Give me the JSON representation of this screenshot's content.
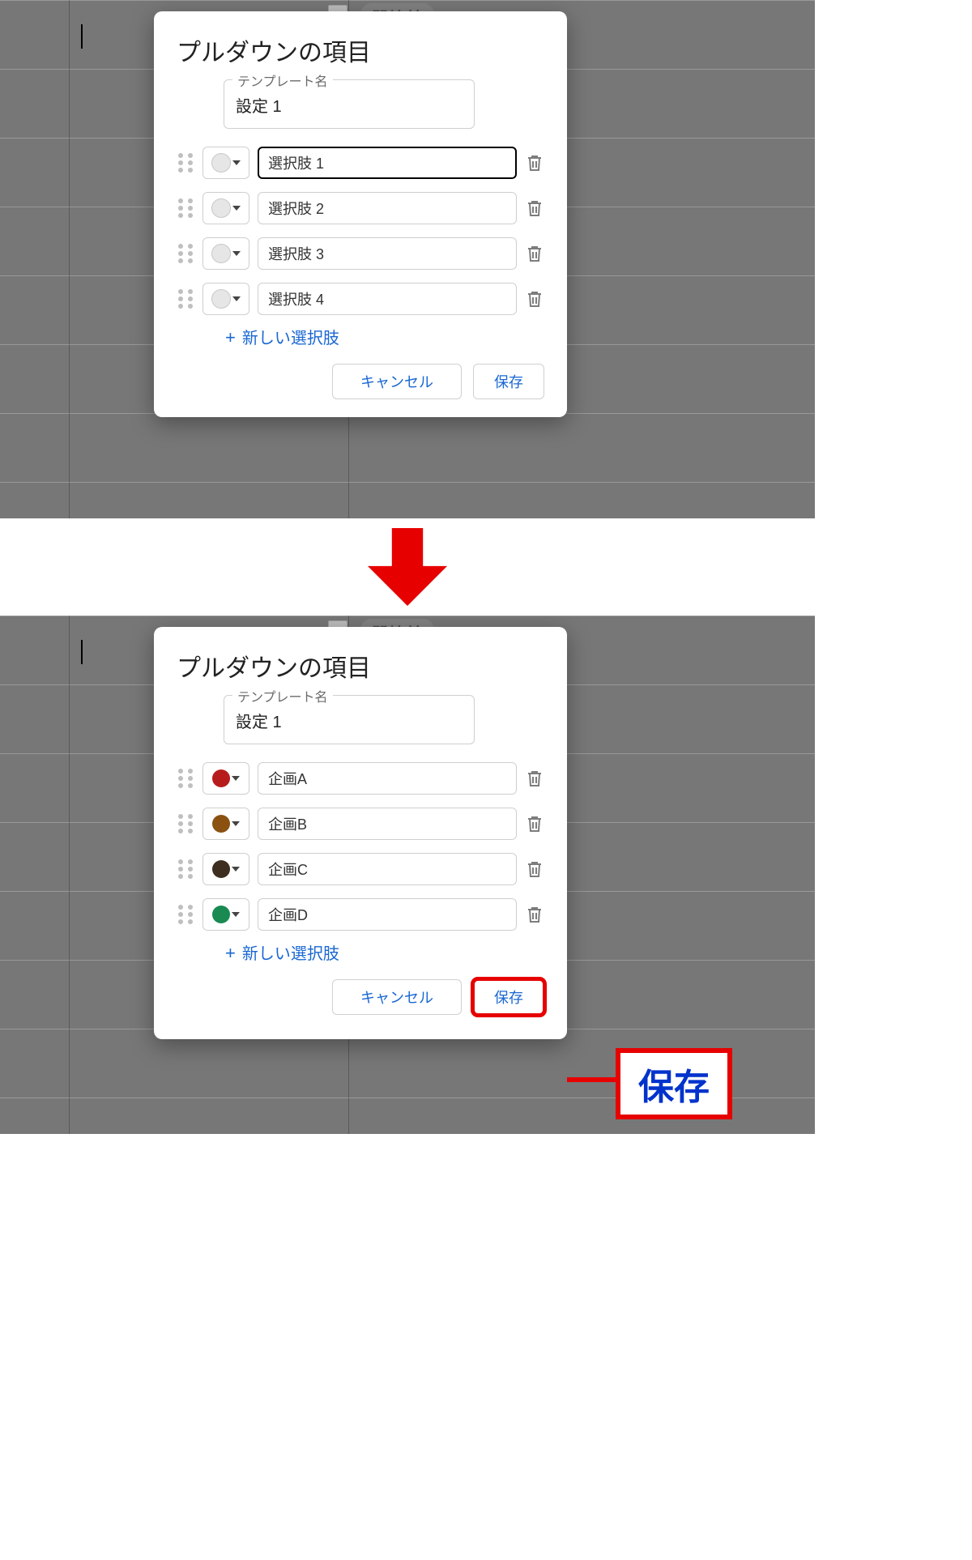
{
  "bg_chip": "開始前",
  "dialog_title": "プルダウンの項目",
  "template_label": "テンプレート名",
  "template_value": "設定 1",
  "add_option_label": "新しい選択肢",
  "cancel_label": "キャンセル",
  "save_label": "保存",
  "callout_label": "保存",
  "state_before": {
    "options": [
      {
        "label": "選択肢 1",
        "color": "#e6e6e6",
        "focused": true
      },
      {
        "label": "選択肢 2",
        "color": "#e6e6e6",
        "focused": false
      },
      {
        "label": "選択肢 3",
        "color": "#e6e6e6",
        "focused": false
      },
      {
        "label": "選択肢 4",
        "color": "#e6e6e6",
        "focused": false
      }
    ]
  },
  "state_after": {
    "options": [
      {
        "label": "企画A",
        "color": "#b71c1c",
        "focused": false
      },
      {
        "label": "企画B",
        "color": "#8a5110",
        "focused": false
      },
      {
        "label": "企画C",
        "color": "#3d2e1f",
        "focused": false
      },
      {
        "label": "企画D",
        "color": "#188a52",
        "focused": false
      }
    ]
  }
}
